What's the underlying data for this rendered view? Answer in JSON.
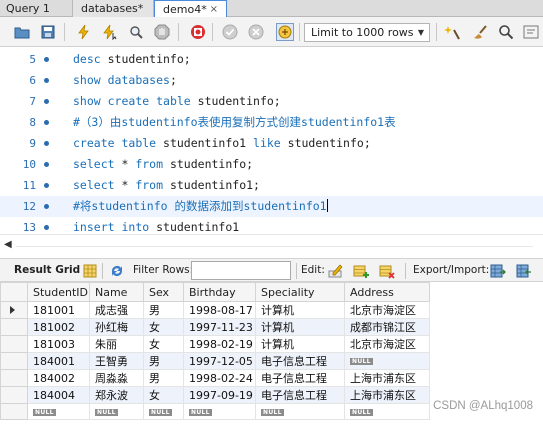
{
  "tabs": [
    {
      "label": "Query 1"
    },
    {
      "label": "databases*"
    },
    {
      "label": "demo4*",
      "close": "×"
    }
  ],
  "toolbar": {
    "limit_label": "Limit to 1000 rows",
    "icons": [
      "folder-open-icon",
      "save-icon",
      "lightning-execute-icon",
      "lightning-cursor-icon",
      "magnifier-explain-icon",
      "stop-icon",
      "stop-on-error-icon",
      "commit-icon",
      "rollback-icon",
      "autocommit-toggle-icon",
      "beautify-icon",
      "brush-icon",
      "find-icon",
      "invisible-chars-icon"
    ]
  },
  "editor": {
    "lines": [
      {
        "num": "5",
        "tokens": [
          {
            "t": "desc ",
            "k": "kw"
          },
          {
            "t": "studentinfo;",
            "k": ""
          }
        ]
      },
      {
        "num": "6",
        "tokens": [
          {
            "t": "show ",
            "k": "kw"
          },
          {
            "t": "databases",
            "k": "kw"
          },
          {
            "t": ";",
            "k": ""
          }
        ]
      },
      {
        "num": "7",
        "tokens": [
          {
            "t": "show ",
            "k": "kw"
          },
          {
            "t": "create ",
            "k": "kw"
          },
          {
            "t": "table ",
            "k": "kw"
          },
          {
            "t": "studentinfo;",
            "k": ""
          }
        ]
      },
      {
        "num": "8",
        "tokens": [
          {
            "t": "#（3）由studentinfo表使用复制方式创建studentinfo1表",
            "k": "cm"
          }
        ]
      },
      {
        "num": "9",
        "tokens": [
          {
            "t": "create ",
            "k": "kw"
          },
          {
            "t": "table ",
            "k": "kw"
          },
          {
            "t": "studentinfo1 ",
            "k": ""
          },
          {
            "t": "like ",
            "k": "kw"
          },
          {
            "t": "studentinfo;",
            "k": ""
          }
        ]
      },
      {
        "num": "10",
        "tokens": [
          {
            "t": "select ",
            "k": "kw"
          },
          {
            "t": "* ",
            "k": ""
          },
          {
            "t": "from ",
            "k": "kw"
          },
          {
            "t": "studentinfo;",
            "k": ""
          }
        ]
      },
      {
        "num": "11",
        "tokens": [
          {
            "t": "select ",
            "k": "kw"
          },
          {
            "t": "* ",
            "k": ""
          },
          {
            "t": "from ",
            "k": "kw"
          },
          {
            "t": "studentinfo1;",
            "k": ""
          }
        ]
      },
      {
        "num": "12",
        "tokens": [
          {
            "t": "#将studentinfo 的数据添加到studentinfo1",
            "k": "cm"
          }
        ],
        "caret": true
      },
      {
        "num": "13",
        "tokens": [
          {
            "t": "insert ",
            "k": "kw"
          },
          {
            "t": "into ",
            "k": "kw"
          },
          {
            "t": "studentinfo1",
            "k": ""
          }
        ]
      }
    ]
  },
  "result_toolbar": {
    "result_grid": "Result Grid",
    "filter_rows": "Filter Rows:",
    "edit": "Edit:",
    "export_import": "Export/Import:"
  },
  "grid": {
    "columns": [
      "StudentID",
      "Name",
      "Sex",
      "Birthday",
      "Speciality",
      "Address"
    ],
    "rows": [
      [
        "181001",
        "成志强",
        "男",
        "1998-08-17",
        "计算机",
        "北京市海淀区"
      ],
      [
        "181002",
        "孙红梅",
        "女",
        "1997-11-23",
        "计算机",
        "成都市锦江区"
      ],
      [
        "181003",
        "朱丽",
        "女",
        "1998-02-19",
        "计算机",
        "北京市海淀区"
      ],
      [
        "184001",
        "王智勇",
        "男",
        "1997-12-05",
        "电子信息工程",
        "NULL"
      ],
      [
        "184002",
        "周淼淼",
        "男",
        "1998-02-24",
        "电子信息工程",
        "上海市浦东区"
      ],
      [
        "184004",
        "郑永波",
        "女",
        "1997-09-19",
        "电子信息工程",
        "上海市浦东区"
      ],
      [
        "NULL",
        "NULL",
        "NULL",
        "NULL",
        "NULL",
        "NULL"
      ]
    ]
  },
  "watermark": "CSDN @ALhq1008"
}
